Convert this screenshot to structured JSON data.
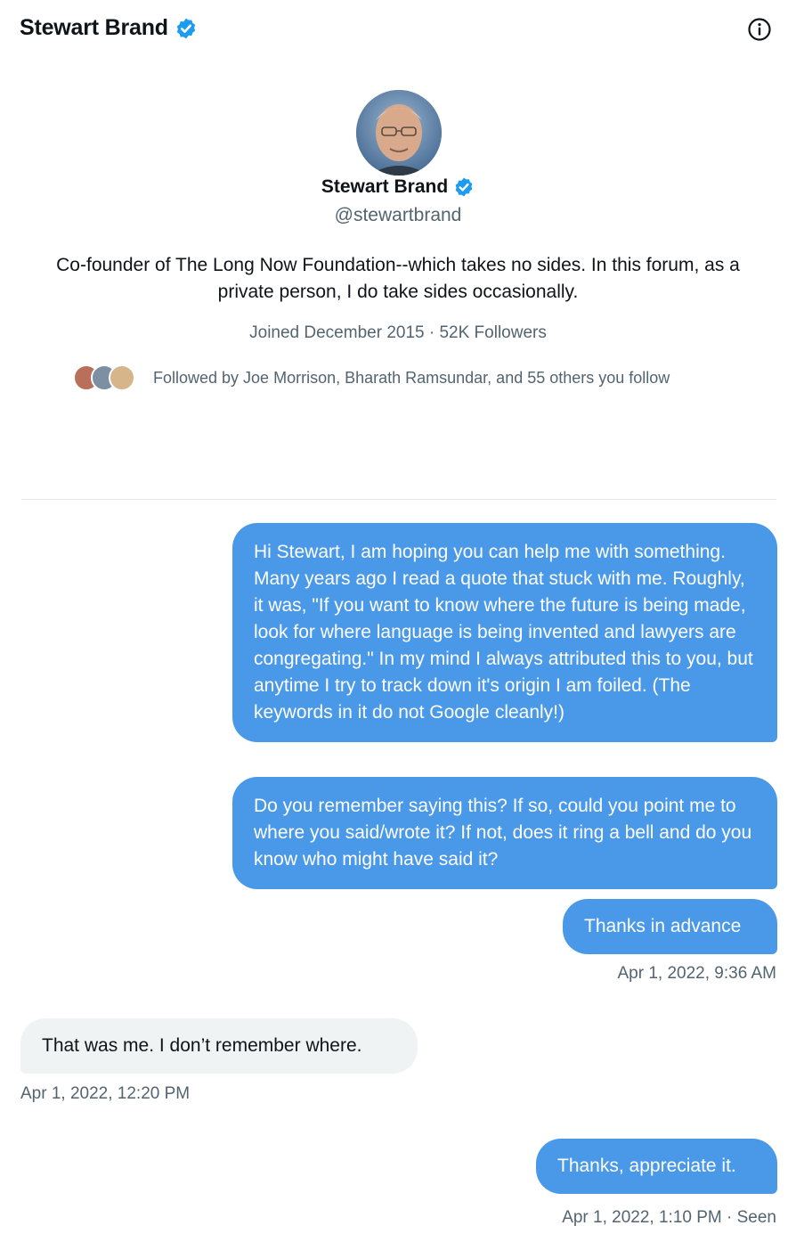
{
  "header": {
    "title": "Stewart Brand",
    "verified_icon": "verified-badge-icon",
    "info_icon": "info-icon"
  },
  "profile": {
    "name": "Stewart Brand",
    "handle": "@stewartbrand",
    "bio": "Co-founder of The Long Now Foundation--which takes no sides.  In this forum, as a private person, I do take sides occasionally.",
    "meta": "Joined December 2015 · 52K Followers",
    "followed_by": "Followed by Joe Morrison, Bharath Ramsundar, and 55 others you follow"
  },
  "messages": [
    {
      "direction": "outgoing",
      "text": "Hi Stewart, I am hoping you can help me with something. Many years ago I read a quote that stuck with me. Roughly, it was, \"If you want to know where the future is being made, look for where language is being invented and lawyers are congregating.\" In my mind I always attributed this to you, but anytime I try to track down it's origin I am foiled. (The keywords in it do not Google cleanly!)"
    },
    {
      "direction": "outgoing",
      "text": "Do you remember saying this? If so, could you point me to where you said/wrote it? If not, does it ring a bell and do you know who might have said it?"
    },
    {
      "direction": "outgoing",
      "text": "Thanks in advance"
    },
    {
      "direction": "incoming",
      "text": "That was me.  I don’t remember where."
    },
    {
      "direction": "outgoing",
      "text": "Thanks, appreciate it."
    }
  ],
  "timestamps": {
    "first_group": "Apr 1, 2022, 9:36 AM",
    "reply": "Apr 1, 2022, 12:20 PM",
    "last": "Apr 1, 2022, 1:10 PM · Seen"
  },
  "colors": {
    "outgoing_bubble": "#4a99e9",
    "incoming_bubble": "#eff3f4",
    "verified": "#1d9bf0",
    "secondary_text": "#536471"
  }
}
